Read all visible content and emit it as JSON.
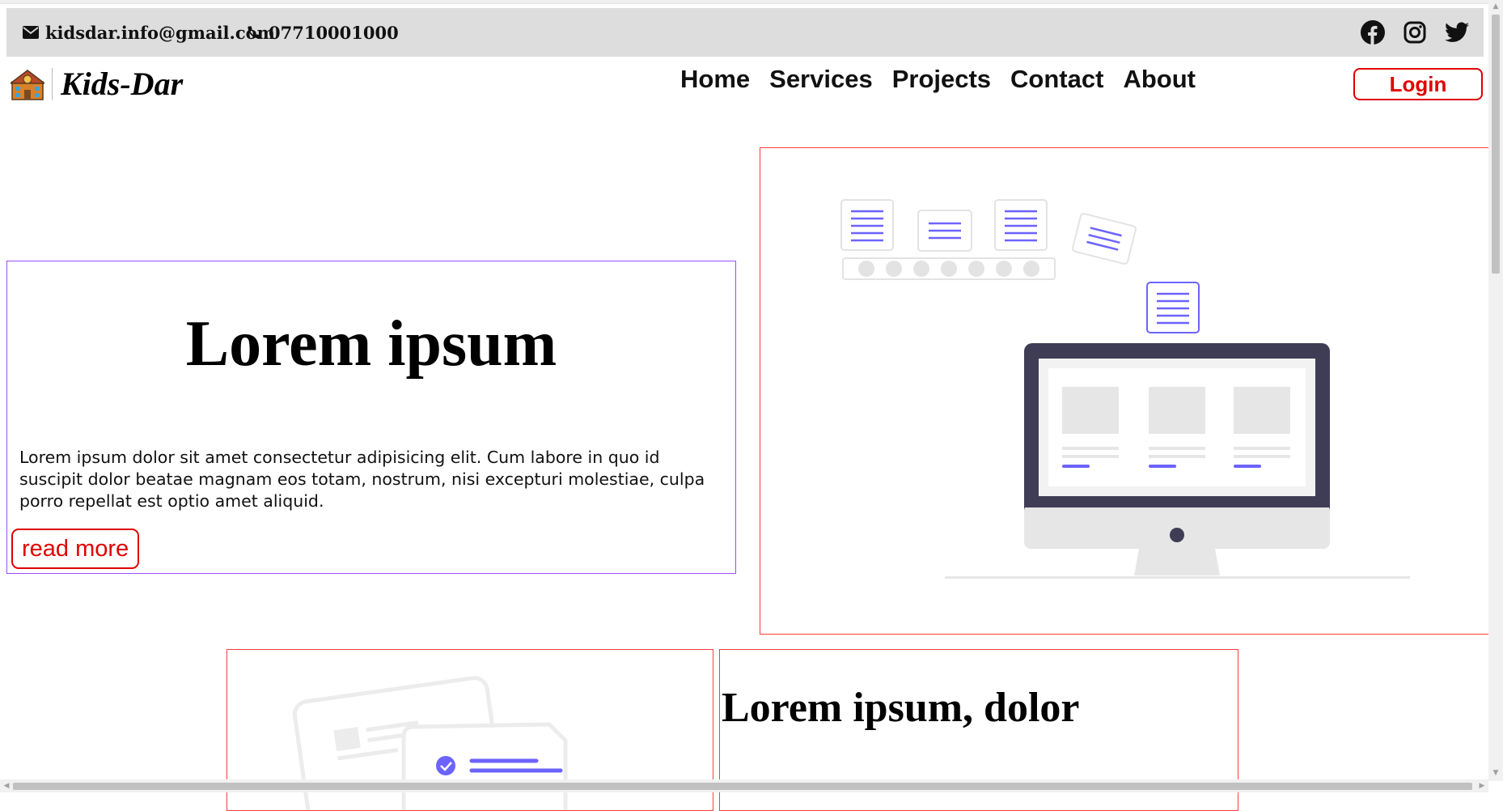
{
  "contact": {
    "email": "kidsdar.info@gmail.com",
    "phone": "07710001000"
  },
  "social": {
    "icons": [
      "facebook-icon",
      "instagram-icon",
      "twitter-icon"
    ]
  },
  "brand": {
    "name": "Kids-Dar",
    "logo_icon": "school-building-icon"
  },
  "nav": {
    "items": [
      {
        "label": "Home"
      },
      {
        "label": "Services"
      },
      {
        "label": "Projects"
      },
      {
        "label": "Contact"
      },
      {
        "label": "About"
      }
    ],
    "login_label": "Login"
  },
  "hero": {
    "title": "Lorem ipsum",
    "text": "Lorem ipsum dolor sit amet consectetur adipisicing elit. Cum labore in quo id suscipit dolor beatae magnam eos totam, nostrum, nisi excepturi molestiae, culpa porro repellat est optio amet aliquid.",
    "button_label": "read more"
  },
  "section2": {
    "title": "Lorem ipsum, dolor"
  },
  "colors": {
    "accent_red": "#e00000",
    "card_border_purple": "#9b4dff",
    "topbar_bg": "#dddddd",
    "illustration_purple": "#6c63ff"
  }
}
